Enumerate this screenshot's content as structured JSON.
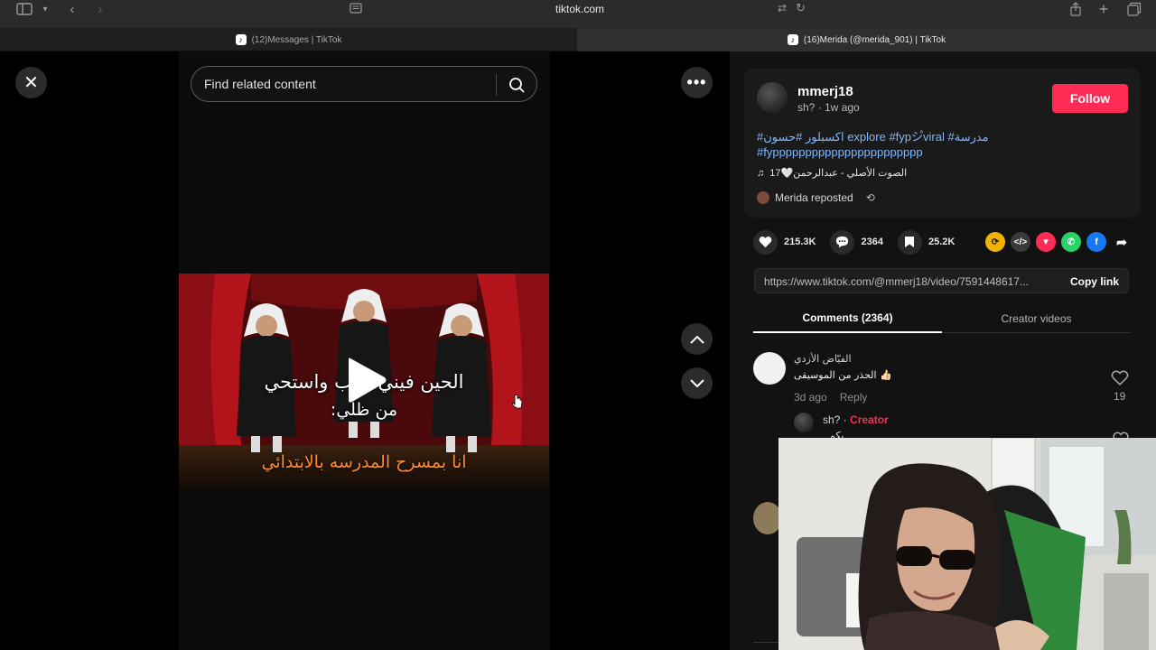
{
  "browser": {
    "url": "tiktok.com",
    "tabs": [
      {
        "title": "(12)Messages | TikTok"
      },
      {
        "title": "(16)Merida (@merida_901) | TikTok"
      }
    ]
  },
  "player": {
    "search_placeholder": "Find related content",
    "caption_line1": "الحين فيني رغب واستحي",
    "caption_line2": "من ظلي:",
    "caption_bottom": "انا بمسرح المدرسه بالابتدائي"
  },
  "post": {
    "username": "mmerj18",
    "subtitle": "sh? · 1w ago",
    "follow_label": "Follow",
    "hashtags_line1": "#اكسبلور #حسون explore #fypシ゚viral #مدرسة",
    "hashtags_line2": "#fyppppppppppppppppppppppp",
    "music": "الصوت الأصلي - عبدالرحمن🤍17",
    "reposted_by": "Merida reposted",
    "likes": "215.3K",
    "comments": "2364",
    "saves": "25.2K",
    "link": "https://www.tiktok.com/@mmerj18/video/7591448617...",
    "copy_label": "Copy link"
  },
  "tabs": {
    "comments_label": "Comments (2364)",
    "creator_label": "Creator videos"
  },
  "comment": {
    "author": "الفيّاض الأزدي",
    "text": "الحذر من الموسيقى 👍🏻",
    "time": "3d ago",
    "reply_label": "Reply",
    "likes": "19",
    "reply_author": "sh?",
    "reply_badge": "Creator",
    "reply_sep": " · ",
    "reply_text": "بكم"
  },
  "colors": {
    "accent": "#fe2c55",
    "hashtag": "#7eb8ff"
  }
}
